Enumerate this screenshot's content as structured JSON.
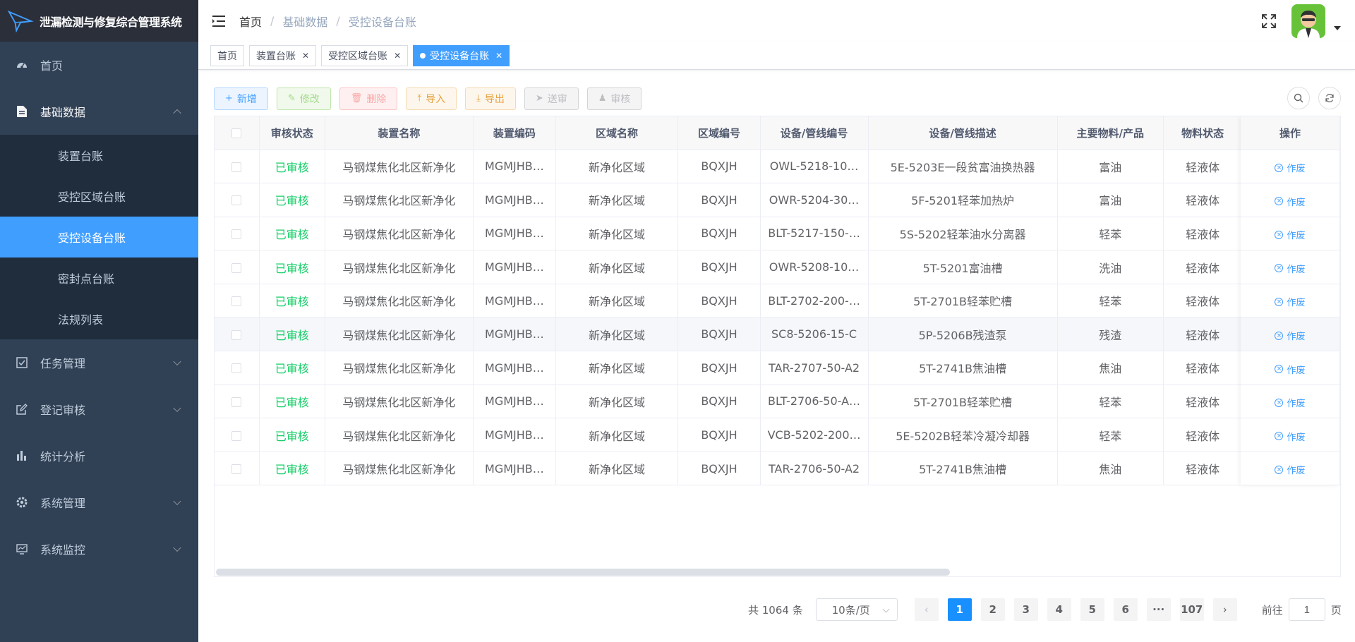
{
  "app": {
    "title": "泄漏检测与修复综合管理系统"
  },
  "sidebar": {
    "items": [
      {
        "label": "首页",
        "icon": "dashboard-icon"
      },
      {
        "label": "基础数据",
        "icon": "document-icon",
        "open": true,
        "children": [
          {
            "label": "装置台账"
          },
          {
            "label": "受控区域台账"
          },
          {
            "label": "受控设备台账",
            "active": true
          },
          {
            "label": "密封点台账"
          },
          {
            "label": "法规列表"
          }
        ]
      },
      {
        "label": "任务管理",
        "icon": "checkbox-icon"
      },
      {
        "label": "登记审核",
        "icon": "edit-icon"
      },
      {
        "label": "统计分析",
        "icon": "chart-icon"
      },
      {
        "label": "系统管理",
        "icon": "gear-icon"
      },
      {
        "label": "系统监控",
        "icon": "monitor-icon"
      }
    ]
  },
  "breadcrumb": [
    "首页",
    "基础数据",
    "受控设备台账"
  ],
  "tags": [
    {
      "label": "首页",
      "closable": false
    },
    {
      "label": "装置台账",
      "closable": true
    },
    {
      "label": "受控区域台账",
      "closable": true
    },
    {
      "label": "受控设备台账",
      "closable": true,
      "active": true
    }
  ],
  "toolbar": {
    "add": "新增",
    "edit": "修改",
    "delete": "删除",
    "import": "导入",
    "export": "导出",
    "submit": "送审",
    "review": "审核"
  },
  "table": {
    "columns": [
      "审核状态",
      "装置名称",
      "装置编码",
      "区域名称",
      "区域编号",
      "设备/管线编号",
      "设备/管线描述",
      "主要物料/产品",
      "物料状态",
      "操作"
    ],
    "action_label": "作废",
    "rows": [
      [
        "已审核",
        "马钢煤焦化北区新净化",
        "MGMJHB…",
        "新净化区域",
        "BQXJH",
        "OWL-5218-10…",
        "5E-5203E一段贫富油换热器",
        "富油",
        "轻液体"
      ],
      [
        "已审核",
        "马钢煤焦化北区新净化",
        "MGMJHB…",
        "新净化区域",
        "BQXJH",
        "OWR-5204-30…",
        "5F-5201轻苯加热炉",
        "富油",
        "轻液体"
      ],
      [
        "已审核",
        "马钢煤焦化北区新净化",
        "MGMJHB…",
        "新净化区域",
        "BQXJH",
        "BLT-5217-150-…",
        "5S-5202轻苯油水分离器",
        "轻苯",
        "轻液体"
      ],
      [
        "已审核",
        "马钢煤焦化北区新净化",
        "MGMJHB…",
        "新净化区域",
        "BQXJH",
        "OWR-5208-10…",
        "5T-5201富油槽",
        "洗油",
        "轻液体"
      ],
      [
        "已审核",
        "马钢煤焦化北区新净化",
        "MGMJHB…",
        "新净化区域",
        "BQXJH",
        "BLT-2702-200-…",
        "5T-2701B轻苯贮槽",
        "轻苯",
        "轻液体"
      ],
      [
        "已审核",
        "马钢煤焦化北区新净化",
        "MGMJHB…",
        "新净化区域",
        "BQXJH",
        "SC8-5206-15-C",
        "5P-5206B残渣泵",
        "残渣",
        "轻液体"
      ],
      [
        "已审核",
        "马钢煤焦化北区新净化",
        "MGMJHB…",
        "新净化区域",
        "BQXJH",
        "TAR-2707-50-A2",
        "5T-2741B焦油槽",
        "焦油",
        "轻液体"
      ],
      [
        "已审核",
        "马钢煤焦化北区新净化",
        "MGMJHB…",
        "新净化区域",
        "BQXJH",
        "BLT-2706-50-A…",
        "5T-2701B轻苯贮槽",
        "轻苯",
        "轻液体"
      ],
      [
        "已审核",
        "马钢煤焦化北区新净化",
        "MGMJHB…",
        "新净化区域",
        "BQXJH",
        "VCB-5202-200…",
        "5E-5202B轻苯冷凝冷却器",
        "轻苯",
        "轻液体"
      ],
      [
        "已审核",
        "马钢煤焦化北区新净化",
        "MGMJHB…",
        "新净化区域",
        "BQXJH",
        "TAR-2706-50-A2",
        "5T-2741B焦油槽",
        "焦油",
        "轻液体"
      ]
    ]
  },
  "pagination": {
    "total": "共 1064 条",
    "page_size": "10条/页",
    "pages": [
      "1",
      "2",
      "3",
      "4",
      "5",
      "6",
      "···",
      "107"
    ],
    "current": "1",
    "goto_prefix": "前往",
    "goto_value": "1",
    "goto_suffix": "页"
  },
  "colors": {
    "primary": "#409eff",
    "sidebar_bg": "#304156",
    "submenu_bg": "#1f2d3d",
    "status_ok": "#13ce66"
  }
}
